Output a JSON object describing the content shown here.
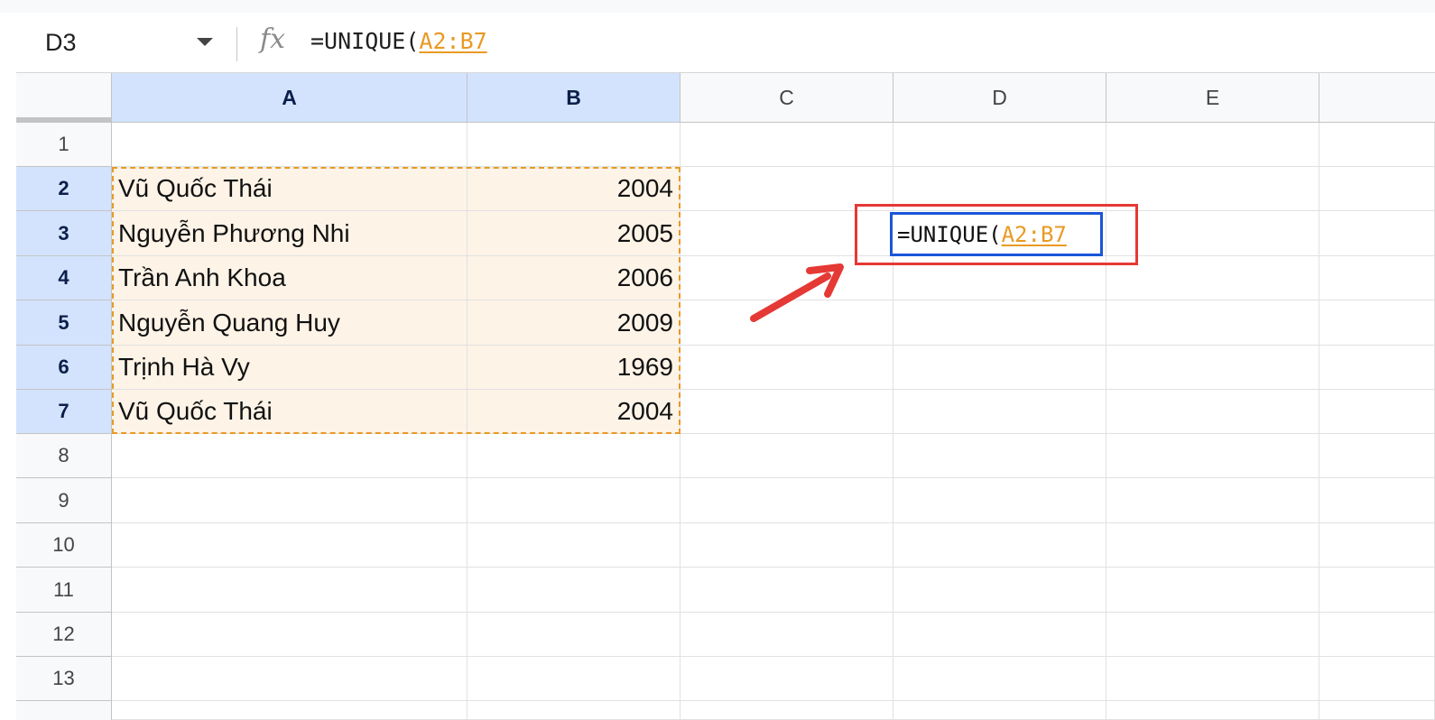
{
  "formula_bar": {
    "name_box": "D3",
    "fx_label": "fx",
    "formula_prefix": "=UNIQUE(",
    "formula_ref": "A2:B7"
  },
  "columns": [
    "A",
    "B",
    "C",
    "D",
    "E"
  ],
  "rows": [
    "1",
    "2",
    "3",
    "4",
    "5",
    "6",
    "7",
    "8",
    "9",
    "10",
    "11",
    "12",
    "13"
  ],
  "data": [
    {
      "a": "Vũ Quốc Thái",
      "b": "2004"
    },
    {
      "a": "Nguyễn Phương Nhi",
      "b": "2005"
    },
    {
      "a": "Trần Anh Khoa",
      "b": "2006"
    },
    {
      "a": "Nguyễn Quang Huy",
      "b": "2009"
    },
    {
      "a": "Trịnh Hà Vy",
      "b": "1969"
    },
    {
      "a": "Vũ Quốc Thái",
      "b": "2004"
    }
  ],
  "active_cell": {
    "prefix": "=UNIQUE(",
    "ref": "A2:B7"
  },
  "colors": {
    "selected_header": "#d3e3fd",
    "range_fill": "#fdf3e7",
    "range_border": "#e89a25",
    "active_border": "#1a56d8",
    "annotation": "#e53935"
  }
}
